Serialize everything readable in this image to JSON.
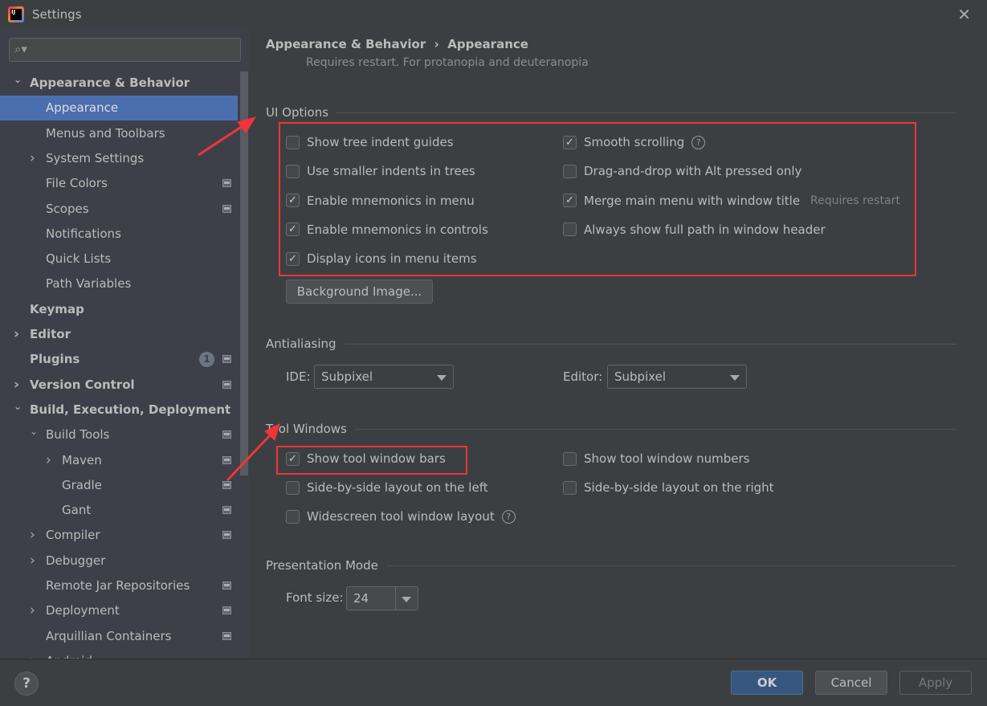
{
  "window": {
    "title": "Settings",
    "close": "✕"
  },
  "search": {
    "placeholder": "",
    "icon": "search-icon"
  },
  "tree": [
    {
      "label": "Appearance & Behavior",
      "level": 0,
      "bold": true,
      "chevron": "down"
    },
    {
      "label": "Appearance",
      "level": 1,
      "selected": true
    },
    {
      "label": "Menus and Toolbars",
      "level": 1
    },
    {
      "label": "System Settings",
      "level": 1,
      "chevron": "right"
    },
    {
      "label": "File Colors",
      "level": 1,
      "project": true
    },
    {
      "label": "Scopes",
      "level": 1,
      "project": true
    },
    {
      "label": "Notifications",
      "level": 1
    },
    {
      "label": "Quick Lists",
      "level": 1
    },
    {
      "label": "Path Variables",
      "level": 1
    },
    {
      "label": "Keymap",
      "level": 0,
      "bold": true
    },
    {
      "label": "Editor",
      "level": 0,
      "bold": true,
      "chevron": "right"
    },
    {
      "label": "Plugins",
      "level": 0,
      "bold": true,
      "project": true,
      "badge": "1"
    },
    {
      "label": "Version Control",
      "level": 0,
      "bold": true,
      "chevron": "right",
      "project": true
    },
    {
      "label": "Build, Execution, Deployment",
      "level": 0,
      "bold": true,
      "chevron": "down"
    },
    {
      "label": "Build Tools",
      "level": 1,
      "chevron": "down",
      "project": true
    },
    {
      "label": "Maven",
      "level": 2,
      "chevron": "right",
      "project": true
    },
    {
      "label": "Gradle",
      "level": 2,
      "project": true
    },
    {
      "label": "Gant",
      "level": 2,
      "project": true
    },
    {
      "label": "Compiler",
      "level": 1,
      "chevron": "right",
      "project": true
    },
    {
      "label": "Debugger",
      "level": 1,
      "chevron": "right"
    },
    {
      "label": "Remote Jar Repositories",
      "level": 1,
      "project": true
    },
    {
      "label": "Deployment",
      "level": 1,
      "chevron": "right",
      "project": true
    },
    {
      "label": "Arquillian Containers",
      "level": 1,
      "project": true
    },
    {
      "label": "Android",
      "level": 1,
      "chevron": "right"
    }
  ],
  "breadcrumb": {
    "parent": "Appearance & Behavior",
    "sep": "›",
    "current": "Appearance"
  },
  "note": "Requires restart. For protanopia and deuteranopia",
  "ui_options": {
    "title": "UI Options",
    "left": [
      {
        "label": "Show tree indent guides",
        "checked": false
      },
      {
        "label": "Use smaller indents in trees",
        "checked": false
      },
      {
        "label": "Enable mnemonics in menu",
        "checked": true
      },
      {
        "label": "Enable mnemonics in controls",
        "checked": true
      },
      {
        "label": "Display icons in menu items",
        "checked": true
      }
    ],
    "right": [
      {
        "label": "Smooth scrolling",
        "checked": true,
        "help": true
      },
      {
        "label": "Drag-and-drop with Alt pressed only",
        "checked": false
      },
      {
        "label": "Merge main menu with window title",
        "checked": true,
        "hint": "Requires restart"
      },
      {
        "label": "Always show full path in window header",
        "checked": false
      }
    ],
    "background_button": "Background Image..."
  },
  "antialiasing": {
    "title": "Antialiasing",
    "ide_label": "IDE:",
    "ide_value": "Subpixel",
    "editor_label": "Editor:",
    "editor_value": "Subpixel"
  },
  "tool_windows": {
    "title": "Tool Windows",
    "items": [
      {
        "label": "Show tool window bars",
        "checked": true
      },
      {
        "label": "Show tool window numbers",
        "checked": false
      },
      {
        "label": "Side-by-side layout on the left",
        "checked": false
      },
      {
        "label": "Side-by-side layout on the right",
        "checked": false
      },
      {
        "label": "Widescreen tool window layout",
        "checked": false,
        "help": true
      }
    ]
  },
  "presentation": {
    "title": "Presentation Mode",
    "font_label": "Font size:",
    "font_value": "24"
  },
  "footer": {
    "help": "?",
    "ok": "OK",
    "cancel": "Cancel",
    "apply": "Apply"
  },
  "colors": {
    "accent": "#4b6eaf",
    "annotation": "#f2333a",
    "ok_button": "#365880"
  }
}
